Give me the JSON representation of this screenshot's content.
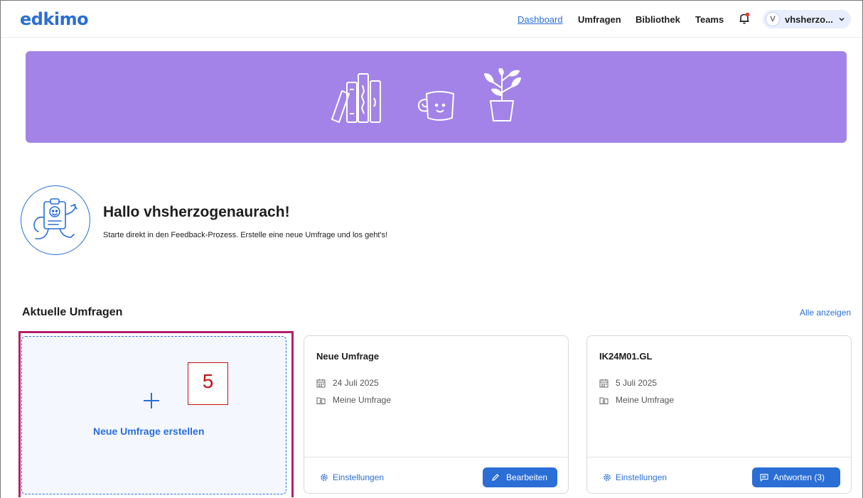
{
  "header": {
    "logo": "edkimo",
    "nav": [
      "Dashboard",
      "Umfragen",
      "Bibliothek",
      "Teams"
    ],
    "user_initial": "V",
    "user_name": "vhsherzo..."
  },
  "greeting": {
    "title": "Hallo vhsherzogenaurach!",
    "subtitle": "Starte direkt in den Feedback-Prozess. Erstelle eine neue Umfrage und los geht's!"
  },
  "section": {
    "title": "Aktuelle Umfragen",
    "show_all": "Alle anzeigen"
  },
  "create_card": {
    "label": "Neue Umfrage erstellen",
    "step_number": "5"
  },
  "cards": [
    {
      "title": "Neue Umfrage",
      "date": "24 Juli 2025",
      "folder": "Meine Umfrage",
      "settings": "Einstellungen",
      "action": "Bearbeiten"
    },
    {
      "title": "IK24M01.GL",
      "date": "5 Juli 2025",
      "folder": "Meine Umfrage",
      "settings": "Einstellungen",
      "action": "Antworten (3)"
    }
  ],
  "colors": {
    "accent": "#2a6ed6",
    "banner": "#a383e8",
    "highlight_frame": "#b31f6c",
    "step_marker": "#c21313",
    "notification_dot": "#e53935"
  },
  "icons": [
    "bell-icon",
    "chevron-down-icon",
    "plus-icon",
    "calendar-icon",
    "folder-icon",
    "gear-icon",
    "pencil-icon",
    "comment-icon",
    "books-illustration",
    "mug-illustration",
    "plant-illustration",
    "mascot-illustration"
  ]
}
